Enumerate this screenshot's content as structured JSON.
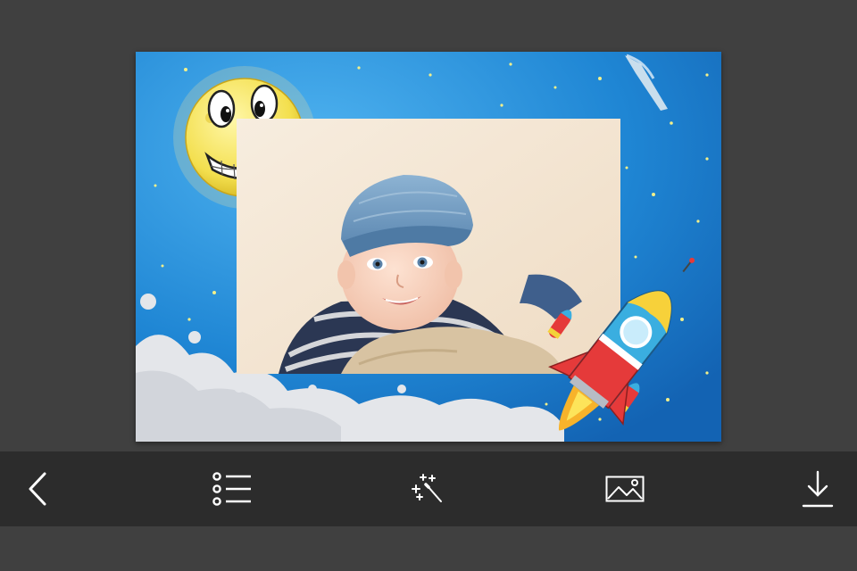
{
  "editor": {
    "canvas": {
      "background": "space-photo-frame",
      "photo": "baby-in-blue-cap",
      "decorations": [
        "smiling-moon",
        "rocket",
        "clouds",
        "stars",
        "comet"
      ]
    }
  },
  "toolbar": {
    "items": [
      {
        "icon": "back-chevron-icon"
      },
      {
        "icon": "frame-list-icon"
      },
      {
        "icon": "magic-wand-icon"
      },
      {
        "icon": "image-gallery-icon"
      },
      {
        "icon": "download-icon"
      }
    ]
  },
  "colors": {
    "background": "#404040",
    "toolbar": "#2c2c2c",
    "icon": "#ffffff",
    "frame_blue": "#1f7fd0"
  }
}
